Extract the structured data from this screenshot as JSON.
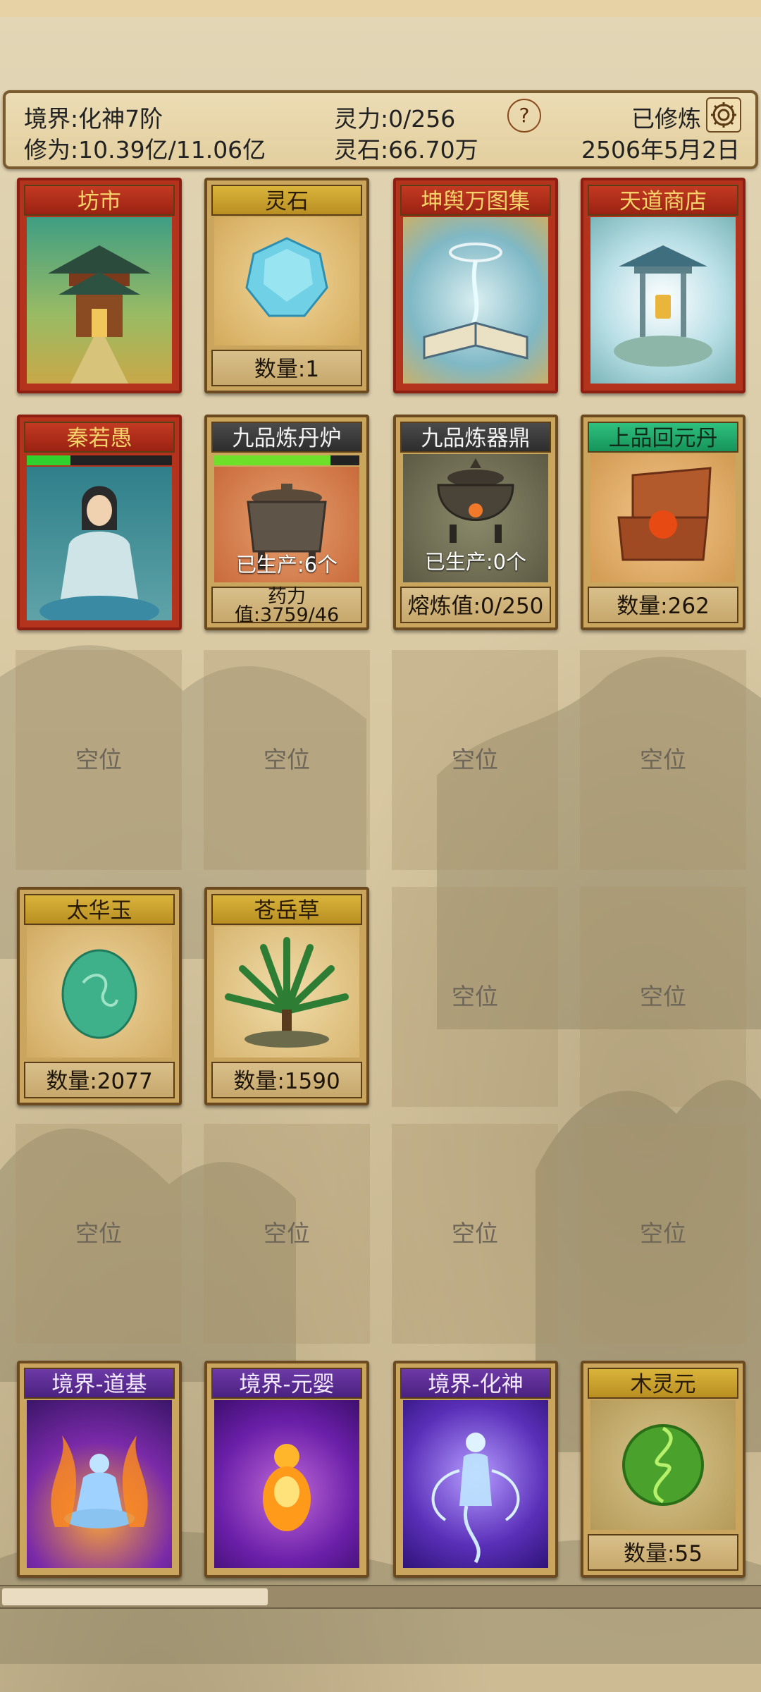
{
  "header": {
    "realm": "境界:化神7阶",
    "cultivation": "修为:10.39亿/11.06亿",
    "spirit_power": "灵力:0/256",
    "spirit_stones": "灵石:66.70万",
    "help": "?",
    "status": "已修炼",
    "date": "2506年5月2日"
  },
  "cards": {
    "market": {
      "title": "坊市"
    },
    "spirit_stone": {
      "title": "灵石",
      "footer": "数量:1"
    },
    "atlas": {
      "title": "坤舆万图集"
    },
    "heaven_shop": {
      "title": "天道商店"
    },
    "character": {
      "title": "秦若愚"
    },
    "pill_furnace": {
      "title": "九品炼丹炉",
      "produced": "已生产:6个",
      "footer_line1": "药力",
      "footer_line2": "值:3759/46"
    },
    "artifact_cauldron": {
      "title": "九品炼器鼎",
      "produced": "已生产:0个",
      "footer": "熔炼值:0/250"
    },
    "huiyuan_pill": {
      "title": "上品回元丹",
      "footer": "数量:262"
    },
    "taihua_jade": {
      "title": "太华玉",
      "footer": "数量:2077"
    },
    "cangyue_grass": {
      "title": "苍岳草",
      "footer": "数量:1590"
    },
    "realm_daoji": {
      "title": "境界-道基"
    },
    "realm_yuanying": {
      "title": "境界-元婴"
    },
    "realm_huashen": {
      "title": "境界-化神"
    },
    "wood_essence": {
      "title": "木灵元",
      "footer": "数量:55"
    }
  },
  "empty_slot_label": "空位",
  "progress": {
    "character_bar_fraction": 0.3,
    "furnace_bar_fraction": 0.8
  },
  "scrollbar_fraction": 0.35
}
